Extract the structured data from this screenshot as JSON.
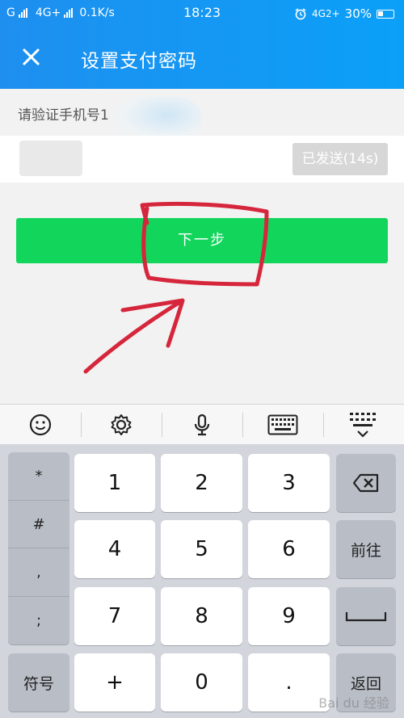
{
  "status_bar": {
    "carrier_left": "G",
    "network": "4G+",
    "speed": "0.1K/s",
    "time": "18:23",
    "network_right": "4G2+",
    "battery": "30%"
  },
  "header": {
    "title": "设置支付密码",
    "close_icon": "close-icon"
  },
  "verify": {
    "label": "请验证手机号1",
    "code_value": "",
    "sent_button": "已发送(14s)"
  },
  "next_button": "下一步",
  "toolbar": {
    "items": [
      "emoji-icon",
      "settings-icon",
      "microphone-icon",
      "keyboard-icon",
      "hide-keyboard-icon"
    ]
  },
  "keyboard": {
    "symbols": [
      "*",
      "#",
      ",",
      ";"
    ],
    "digits": [
      "1",
      "2",
      "3",
      "4",
      "5",
      "6",
      "7",
      "8",
      "9",
      "0"
    ],
    "backspace_icon": "backspace-icon",
    "go_label": "前往",
    "space_icon": "space-icon",
    "symbols_label": "符号",
    "plus_label": "+",
    "dot_label": ".",
    "return_label": "返回"
  },
  "watermark": "Bai du 经验",
  "colors": {
    "header": "#1e8fef",
    "next_button": "#12d65c",
    "annotation": "#d6263c"
  }
}
